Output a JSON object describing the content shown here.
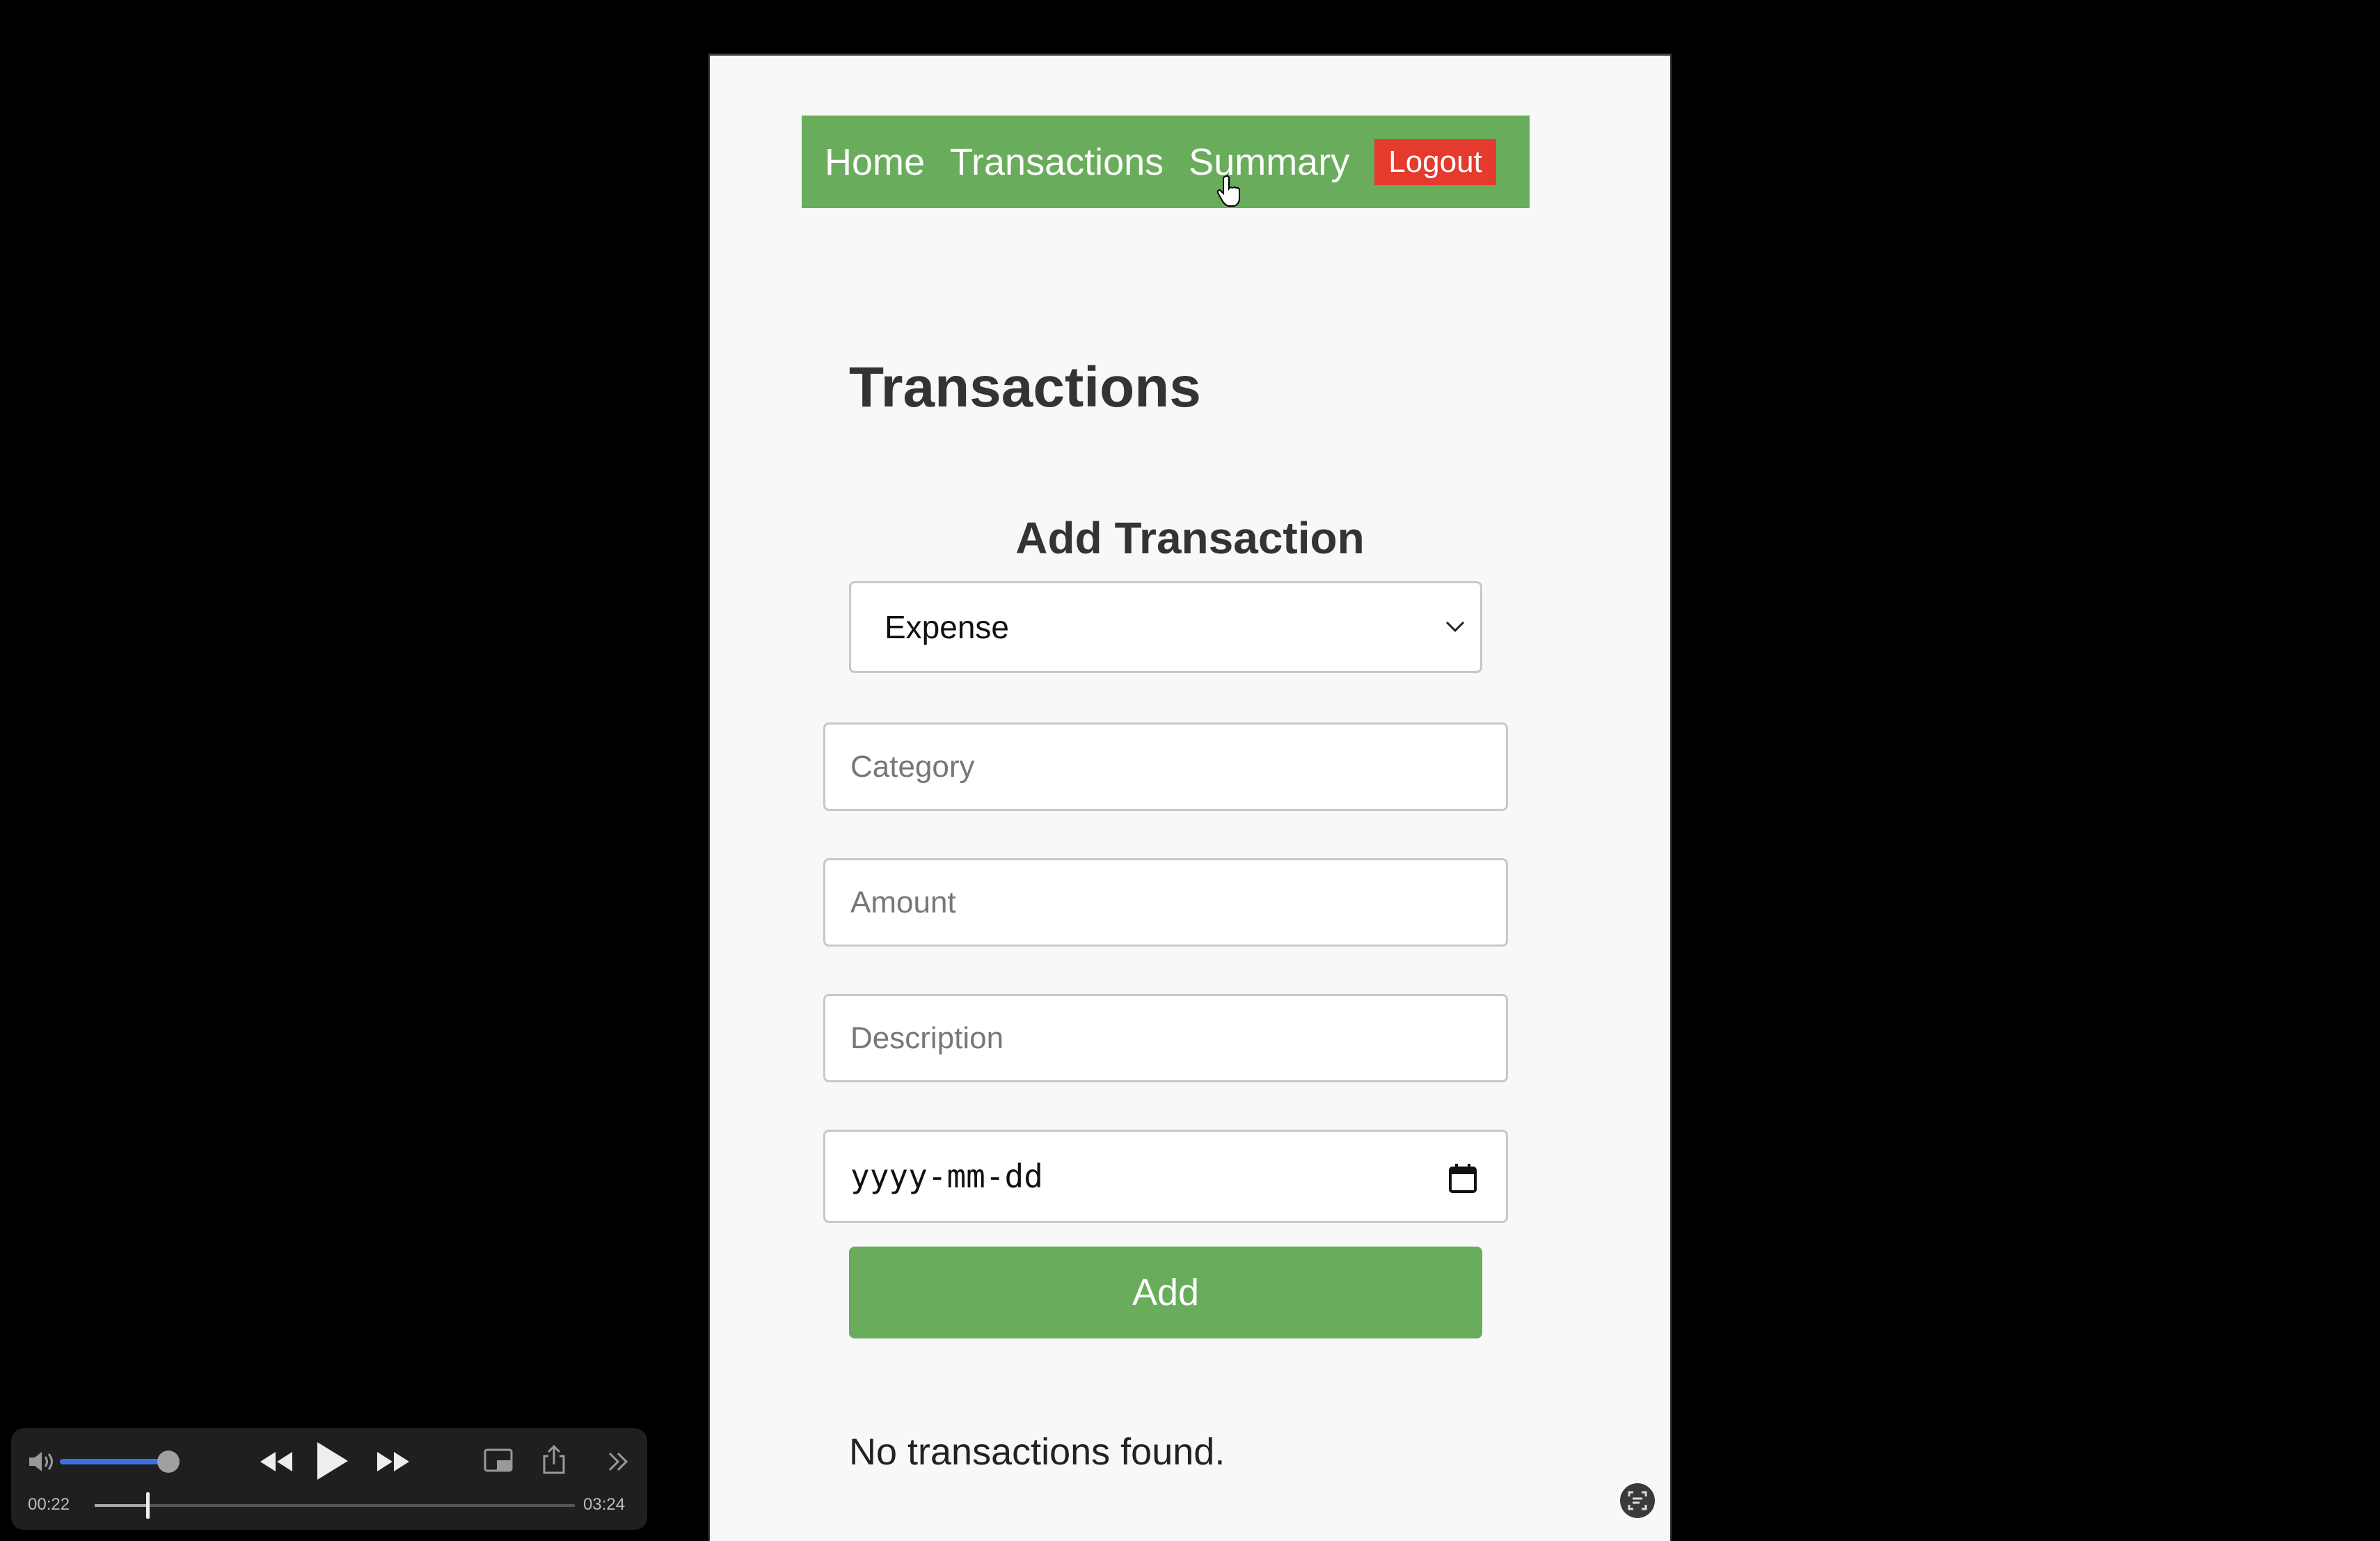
{
  "nav": {
    "home": "Home",
    "transactions": "Transactions",
    "summary": "Summary",
    "logout": "Logout"
  },
  "page": {
    "title": "Transactions",
    "section_title": "Add Transaction"
  },
  "form": {
    "type_value": "Expense",
    "category_placeholder": "Category",
    "amount_placeholder": "Amount",
    "description_placeholder": "Description",
    "date_placeholder": "yyyy-mm-dd",
    "submit_label": "Add"
  },
  "transactions": {
    "empty_message": "No transactions found."
  },
  "player": {
    "elapsed": "00:22",
    "duration": "03:24",
    "progress_fraction": 0.11,
    "volume_fraction": 0.85
  },
  "colors": {
    "nav_bg": "#69ac5b",
    "logout_bg": "#e53a2e",
    "button_bg": "#69ac5b"
  }
}
